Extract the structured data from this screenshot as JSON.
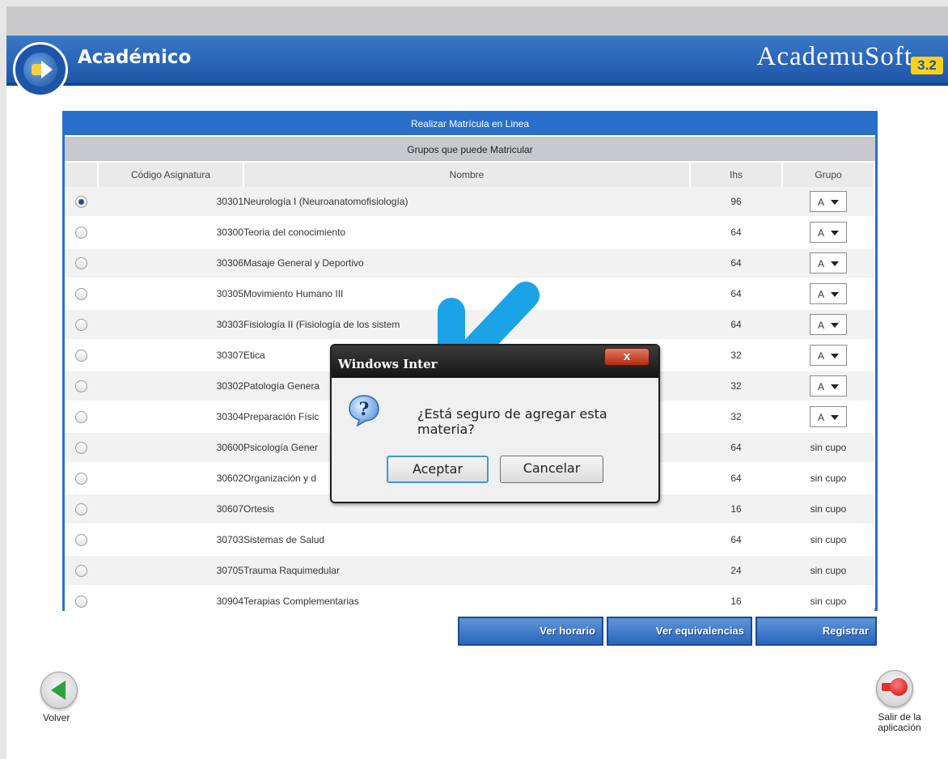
{
  "header": {
    "app_title": "Académico",
    "brand_name": "AcademuSoft",
    "brand_version": "3.2"
  },
  "panel": {
    "title": "Realizar Matrícula en Linea",
    "subtitle": "Grupos que puede Matricular",
    "columns": {
      "code": "Código Asignatura",
      "name": "Nombre",
      "ihs": "Ihs",
      "group": "Grupo"
    },
    "rows": [
      {
        "code": "30301",
        "name": "Neurología I (Neuroanatomofisiología)",
        "ihs": "96",
        "group": "A",
        "status": "",
        "selected": true
      },
      {
        "code": "30300",
        "name": "Teoria del conocimiento",
        "ihs": "64",
        "group": "A",
        "status": ""
      },
      {
        "code": "30306",
        "name": "Masaje General y Deportivo",
        "ihs": "64",
        "group": "A",
        "status": ""
      },
      {
        "code": "30305",
        "name": "Movimiento Humano III",
        "ihs": "64",
        "group": "A",
        "status": ""
      },
      {
        "code": "30303",
        "name": "Fisiología II (Fisiología de los sistem",
        "ihs": "64",
        "group": "A",
        "status": ""
      },
      {
        "code": "30307",
        "name": "Etica",
        "ihs": "32",
        "group": "A",
        "status": ""
      },
      {
        "code": "30302",
        "name": "Patología Genera",
        "ihs": "32",
        "group": "A",
        "status": ""
      },
      {
        "code": "30304",
        "name": "Preparación Físic",
        "ihs": "32",
        "group": "A",
        "status": ""
      },
      {
        "code": "30600",
        "name": "Psicología Gener",
        "ihs": "64",
        "group": "",
        "status": "sin cupo"
      },
      {
        "code": "30602",
        "name": "Organización y d",
        "ihs": "64",
        "group": "",
        "status": "sin cupo"
      },
      {
        "code": "30607",
        "name": "Ortesis",
        "ihs": "16",
        "group": "",
        "status": "sin cupo"
      },
      {
        "code": "30703",
        "name": "Sistemas de Salud",
        "ihs": "64",
        "group": "",
        "status": "sin cupo"
      },
      {
        "code": "30705",
        "name": "Trauma Raquimedular",
        "ihs": "24",
        "group": "",
        "status": "sin cupo"
      },
      {
        "code": "30904",
        "name": "Terapias Complementarias",
        "ihs": "16",
        "group": "",
        "status": "sin cupo"
      }
    ]
  },
  "actions": {
    "schedule": "Ver horario",
    "equivalences": "Ver equivalencias",
    "register": "Registrar"
  },
  "footer": {
    "back_label": "Volver",
    "exit_label_line1": "Salir de la",
    "exit_label_line2": "aplicación"
  },
  "dialog": {
    "title": "Windows Inter",
    "message": "¿Está seguro de agregar esta materia?",
    "ok": "Aceptar",
    "cancel": "Cancelar",
    "close_glyph": "x",
    "icon": "question-icon"
  },
  "colors": {
    "header_blue": "#1e56a8",
    "panel_blue": "#2a6fc9",
    "arrow_blue": "#1aa3e6"
  }
}
